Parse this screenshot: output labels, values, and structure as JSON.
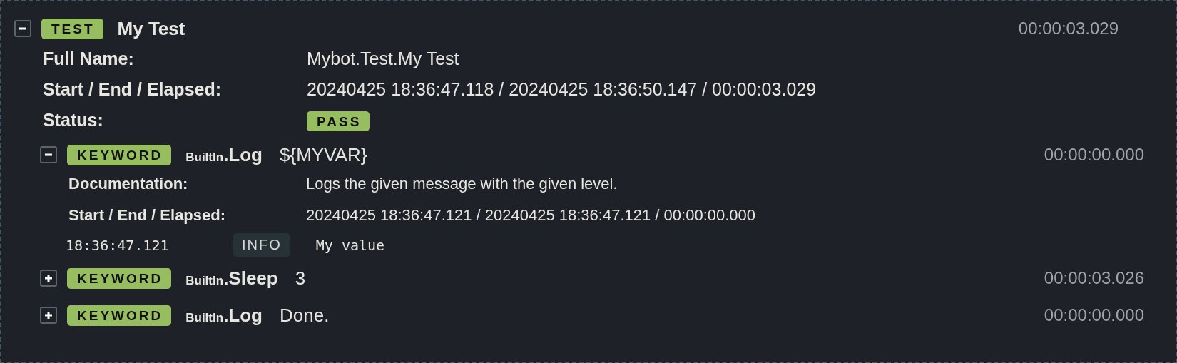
{
  "test": {
    "expanded": true,
    "badge": "TEST",
    "name": "My Test",
    "elapsed": "00:00:03.029",
    "metadata": [
      {
        "label": "Full Name:",
        "value": "Mybot.Test.My Test"
      },
      {
        "label": "Start / End / Elapsed:",
        "value": "20240425 18:36:47.118 / 20240425 18:36:50.147 / 00:00:03.029"
      }
    ],
    "status_label": "Status:",
    "status": "PASS",
    "keywords": [
      {
        "expanded": true,
        "badge": "KEYWORD",
        "library": "BuiltIn",
        "separator": ".",
        "name": "Log",
        "args": "${MYVAR}",
        "elapsed": "00:00:00.000",
        "metadata": [
          {
            "label": "Documentation:",
            "value": "Logs the given message with the given level."
          },
          {
            "label": "Start / End / Elapsed:",
            "value": "20240425 18:36:47.121 / 20240425 18:36:47.121 / 00:00:00.000"
          }
        ],
        "messages": [
          {
            "time": "18:36:47.121",
            "level": "INFO",
            "text": "My value"
          }
        ]
      },
      {
        "expanded": false,
        "badge": "KEYWORD",
        "library": "BuiltIn",
        "separator": ".",
        "name": "Sleep",
        "args": "3",
        "elapsed": "00:00:03.026"
      },
      {
        "expanded": false,
        "badge": "KEYWORD",
        "library": "BuiltIn",
        "separator": ".",
        "name": "Log",
        "args": "Done.",
        "elapsed": "00:00:00.000"
      }
    ]
  }
}
